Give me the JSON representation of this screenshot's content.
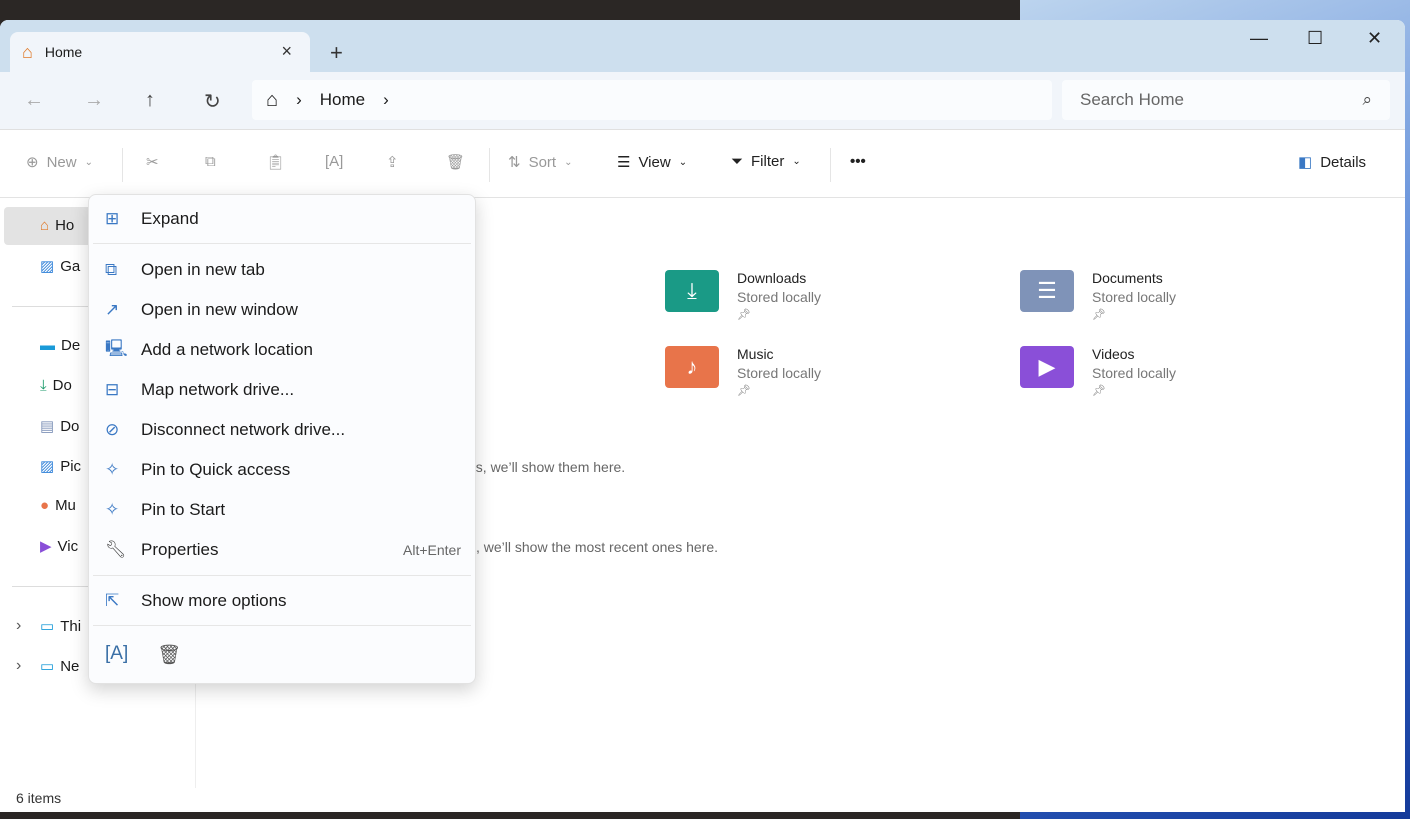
{
  "tab": {
    "title": "Home",
    "close": "×",
    "new_tab": "+"
  },
  "window_controls": {
    "minimize": "—",
    "maximize": "☐",
    "close": "✕"
  },
  "nav": {
    "back": "←",
    "forward": "→",
    "up": "↑",
    "refresh": "↻"
  },
  "breadcrumb": {
    "items": [
      "Home"
    ]
  },
  "search": {
    "placeholder": "Search Home"
  },
  "toolbar": {
    "new": "New",
    "sort": "Sort",
    "view": "View",
    "filter": "Filter",
    "more": "•••",
    "details": "Details"
  },
  "sidebar": {
    "items": [
      {
        "label": "Ho",
        "icon": "home-icon"
      },
      {
        "label": "Ga",
        "icon": "gallery-icon"
      },
      {
        "label": "De",
        "icon": "desktop-icon"
      },
      {
        "label": "Do",
        "icon": "downloads-icon"
      },
      {
        "label": "Do",
        "icon": "documents-icon"
      },
      {
        "label": "Pic",
        "icon": "pictures-icon"
      },
      {
        "label": "Mu",
        "icon": "music-icon"
      },
      {
        "label": "Vic",
        "icon": "videos-icon"
      },
      {
        "label": "Thi",
        "icon": "this-pc-icon"
      },
      {
        "label": "Ne",
        "icon": "network-icon"
      }
    ]
  },
  "quick_access": [
    {
      "name": "Downloads",
      "status": "Stored locally",
      "color": "#1a9a86"
    },
    {
      "name": "Documents",
      "status": "Stored locally",
      "color": "#7f93b8"
    },
    {
      "name": "Music",
      "status": "Stored locally",
      "color": "#e8744a"
    },
    {
      "name": "Videos",
      "status": "Stored locally",
      "color": "#8a4fd8"
    }
  ],
  "hints": {
    "favorites": "es, we’ll show them here.",
    "recent": ", we’ll show the most recent ones here."
  },
  "status_bar": {
    "count": "6 items"
  },
  "context_menu": {
    "items": [
      {
        "label": "Expand",
        "icon": "expand-icon"
      },
      {
        "label": "Open in new tab",
        "icon": "open-new-tab-icon"
      },
      {
        "label": "Open in new window",
        "icon": "open-new-window-icon"
      },
      {
        "label": "Add a network location",
        "icon": "network-location-icon"
      },
      {
        "label": "Map network drive...",
        "icon": "map-drive-icon"
      },
      {
        "label": "Disconnect network drive...",
        "icon": "disconnect-drive-icon"
      },
      {
        "label": "Pin to Quick access",
        "icon": "pin-icon"
      },
      {
        "label": "Pin to Start",
        "icon": "pin-icon"
      },
      {
        "label": "Properties",
        "icon": "wrench-icon",
        "shortcut": "Alt+Enter"
      },
      {
        "label": "Show more options",
        "icon": "more-options-icon"
      }
    ]
  }
}
